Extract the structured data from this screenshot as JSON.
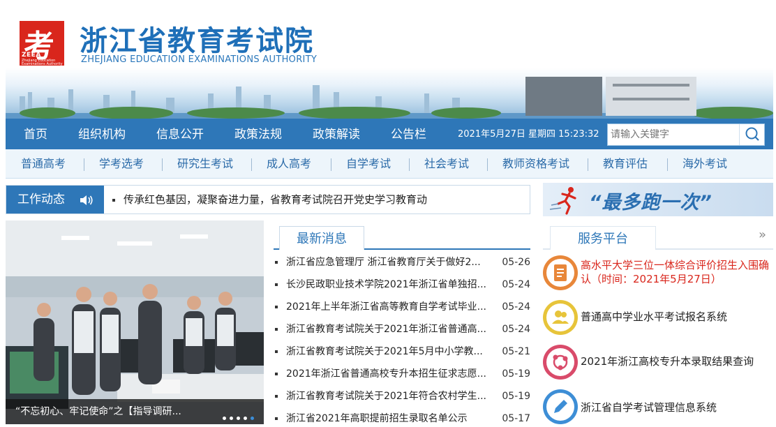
{
  "header": {
    "logo_char": "考",
    "logo_abbr": "ZEEA",
    "logo_sub": "Zhejiang Education Examinations Authority",
    "title": "浙江省教育考试院",
    "subtitle": "ZHEJIANG EDUCATION EXAMINATIONS AUTHORITY",
    "accent": "#2e77b8",
    "logo_color": "#d9261c"
  },
  "nav": {
    "items": [
      "首页",
      "组织机构",
      "信息公开",
      "政策法规",
      "政策解读",
      "公告栏"
    ],
    "datetime": "2021年5月27日 星期四 15:23:32",
    "search_placeholder": "请输入关键字",
    "search_icon": "search-icon"
  },
  "subnav": {
    "items": [
      "普通高考",
      "学考选考",
      "研究生考试",
      "成人高考",
      "自学考试",
      "社会考试",
      "教师资格考试",
      "教育评估",
      "海外考试"
    ]
  },
  "work": {
    "label": "工作动态",
    "icon": "speaker-icon",
    "headline": "传承红色基因，凝聚奋进力量，省教育考试院召开党史学习教育动"
  },
  "zuiduo": {
    "text": "“最多跑一次”"
  },
  "photo": {
    "caption": "“不忘初心、牢记使命”之【指导调研...",
    "slides": 5,
    "active_slide": 5
  },
  "news": {
    "tab": "最新消息",
    "items": [
      {
        "title": "浙江省应急管理厅 浙江省教育厅关于做好2...",
        "date": "05-26"
      },
      {
        "title": "长沙民政职业技术学院2021年浙江省单独招...",
        "date": "05-24"
      },
      {
        "title": "2021年上半年浙江省高等教育自学考试毕业...",
        "date": "05-24"
      },
      {
        "title": "浙江省教育考试院关于2021年浙江省普通高...",
        "date": "05-24"
      },
      {
        "title": "浙江省教育考试院关于2021年5月中小学教...",
        "date": "05-21"
      },
      {
        "title": "2021年浙江省普通高校专升本招生征求志愿...",
        "date": "05-19"
      },
      {
        "title": "浙江省教育考试院关于2021年符合农村学生...",
        "date": "05-19"
      },
      {
        "title": "浙江省2021年高职提前招生录取名单公示",
        "date": "05-17"
      }
    ]
  },
  "services": {
    "tab": "服务平台",
    "more": "»",
    "items": [
      {
        "text": "高水平大学三位一体综合评价招生入围确认（时间：2021年5月27日）",
        "color": "#e8873a",
        "highlight": "#d9261c",
        "icon": "document-icon"
      },
      {
        "text": "普通高中学业水平考试报名系统",
        "color": "#e7c43a",
        "highlight": "#222222",
        "icon": "users-icon"
      },
      {
        "text": "2021年浙江高校专升本录取结果查询",
        "color": "#d94b6a",
        "highlight": "#222222",
        "icon": "share-icon"
      },
      {
        "text": "浙江省自学考试管理信息系统",
        "color": "#3d8ed6",
        "highlight": "#222222",
        "icon": "pen-icon"
      }
    ]
  }
}
